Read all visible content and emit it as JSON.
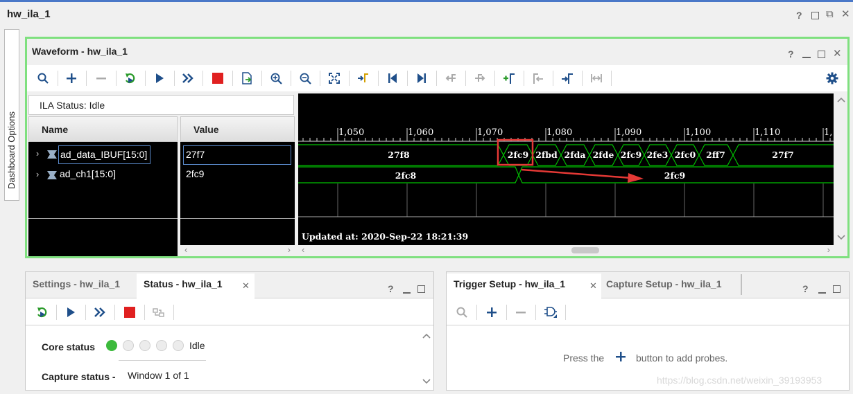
{
  "window": {
    "title": "hw_ila_1"
  },
  "side_tab": {
    "label": "Dashboard Options"
  },
  "waveform": {
    "title": "Waveform - hw_ila_1",
    "ila_status": "ILA Status:  Idle",
    "name_header": "Name",
    "value_header": "Value",
    "signals": [
      {
        "name": "ad_data_IBUF[15:0]",
        "value": "27f7"
      },
      {
        "name": "ad_ch1[15:0]",
        "value": "2fc9"
      }
    ],
    "ruler_labels": [
      "1,050",
      "1,060",
      "1,070",
      "1,080",
      "1,090",
      "1,100",
      "1,110",
      "1,"
    ],
    "row1_values": [
      "27f8",
      "2fc9",
      "2fbd",
      "2fda",
      "2fde",
      "2fc9",
      "2fe3",
      "2fc0",
      "2ff7",
      "27f7"
    ],
    "row2_values": [
      "2fc8",
      "2fc9"
    ],
    "updated": "Updated at: 2020-Sep-22 18:21:39"
  },
  "status_panel": {
    "tabs": [
      "Settings - hw_ila_1",
      "Status - hw_ila_1"
    ],
    "core_status_label": "Core status",
    "core_status_value": "Idle",
    "capture_status_label": "Capture status -",
    "capture_status_value": "Window 1 of 1"
  },
  "trigger_panel": {
    "tabs": [
      "Trigger Setup - hw_ila_1",
      "Capture Setup - hw_ila_1"
    ],
    "hint_before": "Press the",
    "hint_after": "button to add probes."
  },
  "watermark": "https://blog.csdn.net/weixin_39193953",
  "colors": {
    "accent_green": "#7fe07f",
    "wave_green": "#00c000",
    "title_blue": "#3b6fc2",
    "stop_red": "#e02020",
    "highlight_red": "#e53935"
  }
}
